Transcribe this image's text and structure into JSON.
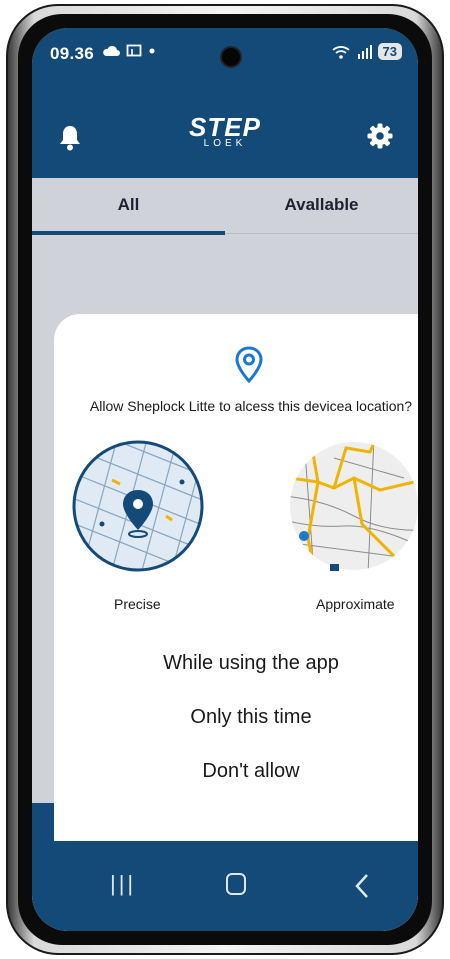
{
  "status_bar": {
    "time": "09.36",
    "battery": "73"
  },
  "header": {
    "brand_main": "STEP",
    "brand_sub": "LOEK",
    "left_icon": "bell-icon",
    "right_icon": "gear-icon"
  },
  "tabs": [
    {
      "label": "All",
      "selected": true
    },
    {
      "label": "Avallable",
      "selected": false
    }
  ],
  "dialog": {
    "icon": "location-pin-icon",
    "question": "Allow Sheplock Litte to alcess this devicea location?",
    "precise_label": "Precise",
    "approximate_label": "Approximate",
    "options": [
      "While using the app",
      "Only this time",
      "Don't allow"
    ]
  },
  "navbar": {
    "icons": [
      "recents-icon",
      "home-icon",
      "back-icon"
    ]
  },
  "colors": {
    "primary": "#134a78",
    "accent": "#1a78d2",
    "map_road_yellow": "#f0b400"
  }
}
